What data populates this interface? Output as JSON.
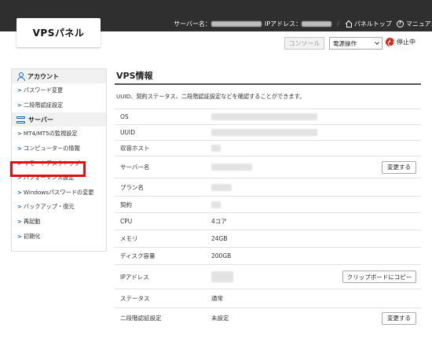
{
  "header": {
    "logo": "VPSパネル",
    "server_name_label": "サーバー名：",
    "ip_label": "IPアドレス：",
    "separator": "/",
    "panel_top": "パネルトップ",
    "manual": "マニュアル"
  },
  "actions": {
    "console": "コンソール",
    "power_select": "電源操作",
    "status": "停止中"
  },
  "sidebar": {
    "account_heading": "アカウント",
    "account_items": [
      "パスワード変更",
      "二段階認証設定"
    ],
    "server_heading": "サーバー",
    "server_items": [
      "MT4/MT5の監視設定",
      "コンピューターの情報",
      "リモートデスクトップ",
      "パフォーマンス設定",
      "Windowsパスワードの変更",
      "バックアップ・復元",
      "再起動",
      "初期化"
    ],
    "highlighted_item": "リモートデスクトップ"
  },
  "main": {
    "title": "VPS情報",
    "description": "UUID、契約ステータス、二段階認証設定などを確認することができます。",
    "rows": [
      {
        "label": "OS",
        "value": ""
      },
      {
        "label": "UUID",
        "value": ""
      },
      {
        "label": "収容ホスト",
        "value": ""
      },
      {
        "label": "サーバー名",
        "value": "",
        "button": "変更する"
      },
      {
        "label": "プラン名",
        "value": ""
      },
      {
        "label": "契約",
        "value": ""
      },
      {
        "label": "CPU",
        "value": "4コア"
      },
      {
        "label": "メモリ",
        "value": "24GB"
      },
      {
        "label": "ディスク容量",
        "value": "200GB"
      },
      {
        "label": "IPアドレス",
        "value": "",
        "button": "クリップボードにコピー"
      },
      {
        "label": "ステータス",
        "value": "通常"
      },
      {
        "label": "二段階認証設定",
        "value": "未設定",
        "button": "変更する"
      }
    ]
  },
  "colors": {
    "header_bg": "#2f2f2f",
    "accent_blue": "#1565c0",
    "highlight_red": "#e01010",
    "status_red": "#d9261c"
  }
}
